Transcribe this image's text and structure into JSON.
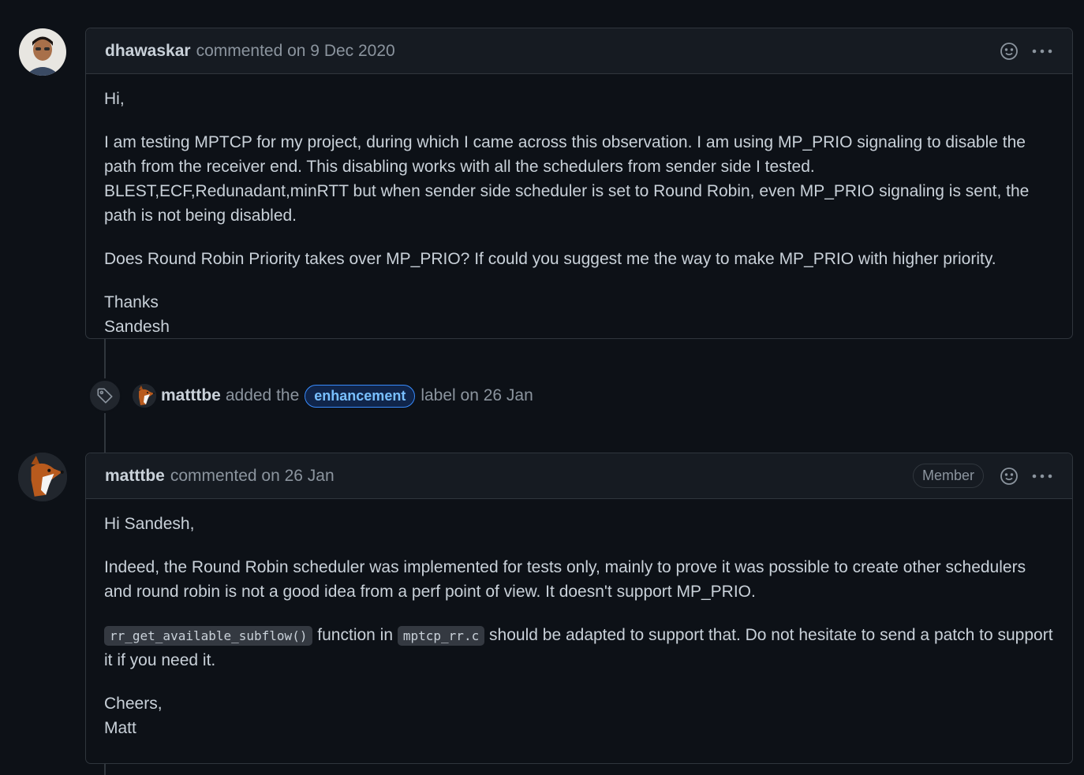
{
  "comment1": {
    "author": "dhawaskar",
    "meta": "commented on 9 Dec 2020",
    "greeting": "Hi,",
    "paragraph1": "I am testing MPTCP for my project, during which I came across this observation. I am using MP_PRIO signaling to disable the path from the receiver end. This disabling works with all the schedulers from sender side I tested. BLEST,ECF,Redunadant,minRTT but when sender side scheduler is set to Round Robin, even MP_PRIO signaling is sent, the path is not being disabled.",
    "paragraph2": "Does Round Robin Priority takes over MP_PRIO? If could you suggest me the way to make MP_PRIO with higher priority.",
    "signoff1": "Thanks",
    "signoff2": "Sandesh"
  },
  "event": {
    "icon": "tag-icon",
    "actor": "matttbe",
    "action": "added the",
    "label": "enhancement",
    "suffix": "label on 26 Jan"
  },
  "comment2": {
    "author": "matttbe",
    "meta": "commented on 26 Jan",
    "badge": "Member",
    "greeting": "Hi Sandesh,",
    "paragraph1": "Indeed, the Round Robin scheduler was implemented for tests only, mainly to prove it was possible to create other schedulers and round robin is not a good idea from a perf point of view. It doesn't support MP_PRIO.",
    "code1": "rr_get_available_subflow()",
    "text_between": "function in",
    "code2": "mptcp_rr.c",
    "text_after": "should be adapted to support that. Do not hesitate to send a patch to support it if you need it.",
    "signoff1": "Cheers,",
    "signoff2": "Matt"
  },
  "colors": {
    "background": "#0d1117",
    "header_bg": "#161b22",
    "border": "#30363d",
    "text": "#c9d1d9",
    "muted": "#8b949e",
    "label_accent": "#388bfd"
  }
}
